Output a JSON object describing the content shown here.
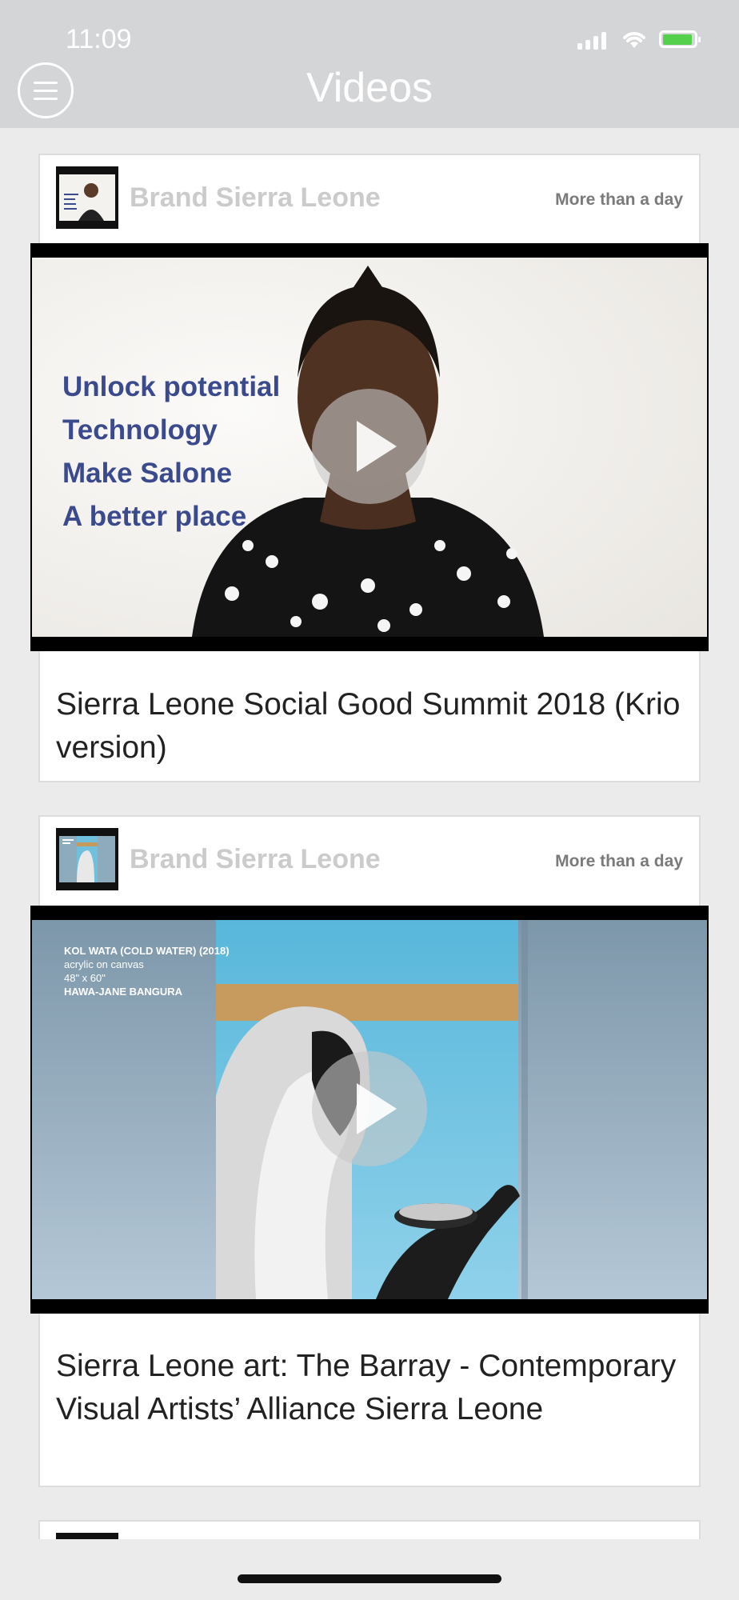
{
  "status_bar": {
    "time": "11:09"
  },
  "header": {
    "title": "Videos",
    "menu_icon": "hamburger-menu-icon"
  },
  "videos": [
    {
      "author": "Brand Sierra Leone",
      "timestamp": "More than a day",
      "title": "Sierra Leone Social Good Summit 2018 (Krio version)",
      "thumbnail_text": [
        "Unlock potential",
        "Technology",
        "Make Salone",
        "A better place"
      ]
    },
    {
      "author": "Brand Sierra Leone",
      "timestamp": "More than a day",
      "title": "Sierra Leone art: The Barray - Contemporary Visual Artists’ Alliance Sierra Leone",
      "thumbnail_caption": {
        "line1": "KOL WATA (COLD WATER) (2018)",
        "line2": "acrylic on canvas",
        "line3": "48\" x 60\"",
        "line4": "HAWA-JANE BANGURA"
      }
    }
  ],
  "colors": {
    "header_bg": "#d4d5d7",
    "page_bg": "#ebebeb",
    "battery_green": "#54d04c"
  }
}
